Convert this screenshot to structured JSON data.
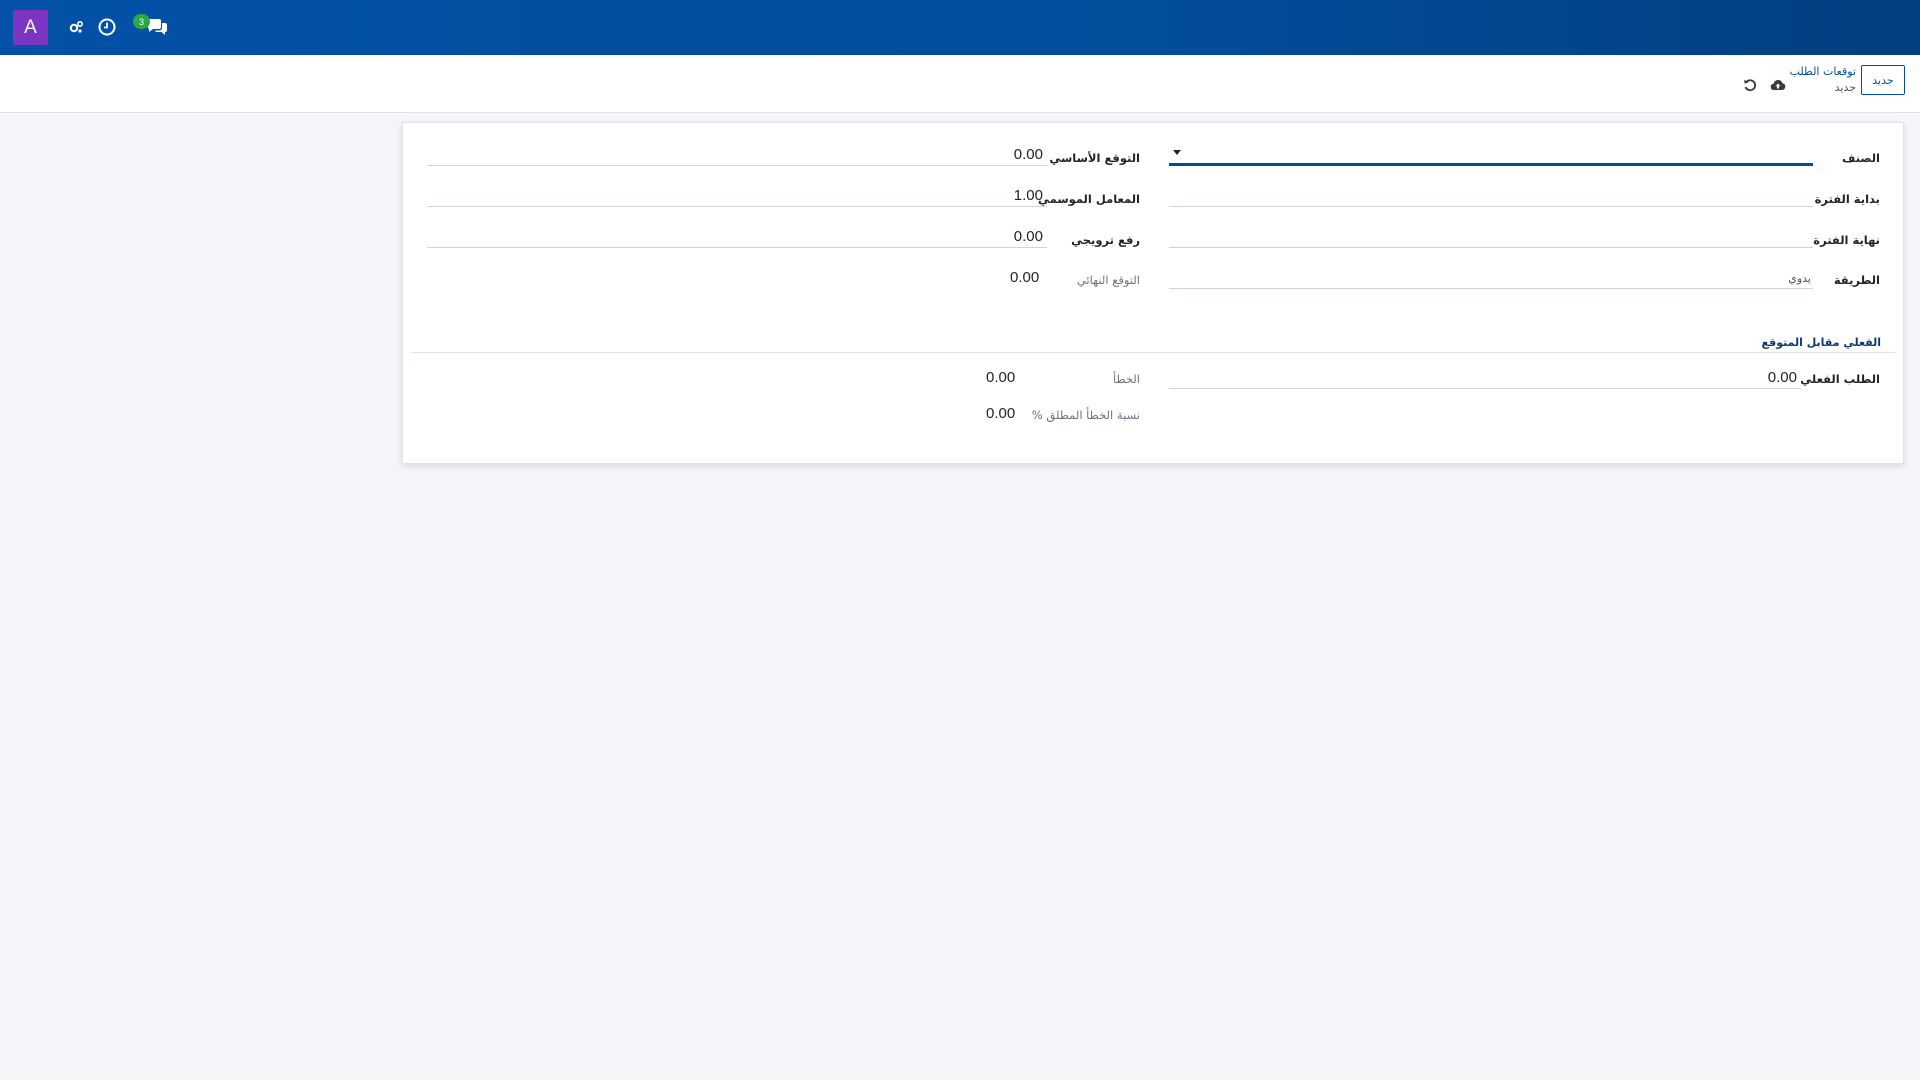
{
  "navbar": {
    "avatar_letter": "A",
    "messages_count": "3",
    "icons": [
      "settings-icon",
      "clock-icon",
      "chat-icon"
    ]
  },
  "control_panel": {
    "new_button": "جديد",
    "breadcrumb_parent": "توقعات الطلب",
    "breadcrumb_current": "جديد",
    "icons": [
      "save-cloud-icon",
      "discard-icon"
    ]
  },
  "form": {
    "product": {
      "label": "الصنف",
      "value": ""
    },
    "period_start": {
      "label": "بداية الفترة",
      "value": ""
    },
    "period_end": {
      "label": "نهاية الفترة",
      "value": ""
    },
    "method": {
      "label": "الطريقة",
      "value": "يدوي"
    },
    "base_forecast": {
      "label": "التوقع الأساسي",
      "value": "0.00"
    },
    "seasonal_factor": {
      "label": "المعامل الموسمي",
      "value": "1.00"
    },
    "promo_uplift": {
      "label": "رفع ترويجي",
      "value": "0.00"
    },
    "final_forecast": {
      "label": "التوقع النهائي",
      "value": "0.00"
    },
    "section_actual_vs_forecast": "الفعلي مقابل المتوقع",
    "actual_demand": {
      "label": "الطلب الفعلي",
      "value": "0.00"
    },
    "error": {
      "label": "الخطأ",
      "value": "0.00"
    },
    "abs_error_pct": {
      "label": "نسبة الخطأ المطلق %",
      "value": "0.00"
    }
  },
  "colors": {
    "navbar": "#024d9c",
    "avatar": "#7b34c4",
    "badge": "#28a745",
    "accent": "#024d9c"
  }
}
